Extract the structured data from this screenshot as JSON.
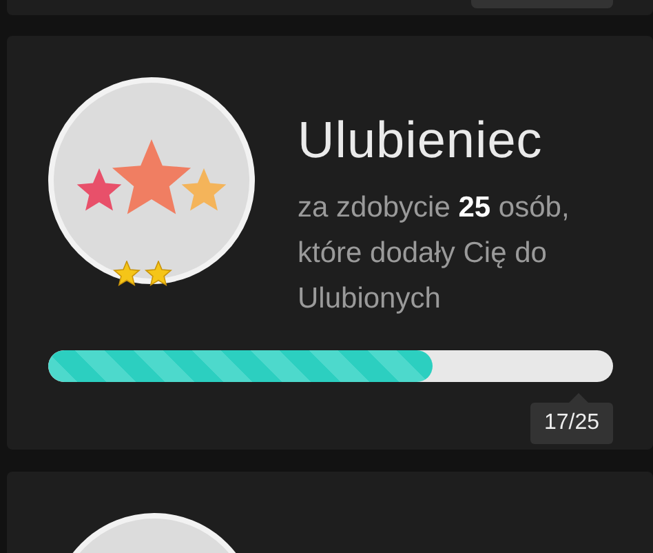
{
  "achievement": {
    "title": "Ulubieniec",
    "description": "za zdobycie **25** osób, które dodały Cię do Ulubionych",
    "level": 0.68,
    "progress_label": "17/25"
  }
}
